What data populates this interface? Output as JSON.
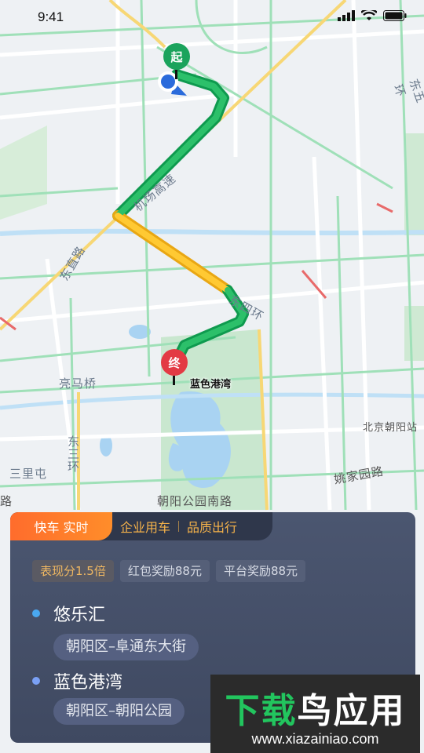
{
  "status_bar": {
    "time": "9:41"
  },
  "map": {
    "road_labels": [
      "东五环",
      "机场高速",
      "东直路",
      "东四环",
      "亮马桥",
      "东三环",
      "三里屯",
      "朝阳公园南路",
      "姚家园路",
      "北京朝阳站",
      "路"
    ],
    "start_marker": "起",
    "end_marker": "终",
    "destination_label": "蓝色港湾"
  },
  "panel": {
    "tab_active": "快车 实时",
    "tabs": [
      "企业用车",
      "品质出行"
    ],
    "badges": [
      "表现分1.5倍",
      "红包奖励88元",
      "平台奖励88元"
    ],
    "origin": {
      "name": "悠乐汇",
      "address": "朝阳区–阜通东大街"
    },
    "destination": {
      "name": "蓝色港湾",
      "address": "朝阳区–朝阳公园"
    }
  },
  "watermark": {
    "title_a": "下载",
    "title_b": "鸟应用",
    "url": "www.xiazainiao.com"
  },
  "colors": {
    "route_green": "#1aa35c",
    "route_yellow": "#f2b31b",
    "accent_orange": "#ff7a2b",
    "panel_bg": "#434d66"
  }
}
